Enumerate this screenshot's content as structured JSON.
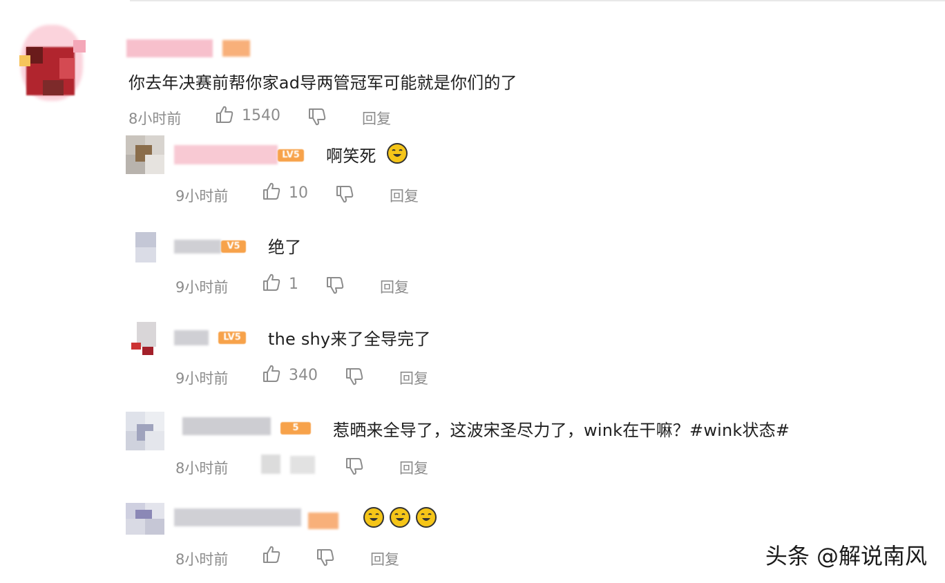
{
  "comments": [
    {
      "time": "8小时前",
      "likes": "1540",
      "reply_label": "回复",
      "text": "你去年决赛前帮你家ad导两管冠军可能就是你们的了"
    },
    {
      "time": "9小时前",
      "likes": "10",
      "reply_label": "回复",
      "text": "啊笑死",
      "badge": "LV5"
    },
    {
      "time": "9小时前",
      "likes": "1",
      "reply_label": "回复",
      "text": "绝了",
      "badge": "V5"
    },
    {
      "time": "9小时前",
      "likes": "340",
      "reply_label": "回复",
      "text": "the shy来了全导完了",
      "badge": "LV5"
    },
    {
      "time": "8小时前",
      "reply_label": "回复",
      "text": "惹晒来全导了，这波宋圣尽力了，wink在干嘛？#wink状态#",
      "badge": "5"
    },
    {
      "time": "8小时前",
      "reply_label": "回复"
    }
  ],
  "watermark": "头条 @解说南风",
  "icons": {
    "like": "thumbs-up-icon",
    "dislike": "thumbs-down-icon",
    "emoji": "laughing-emoji-icon"
  },
  "colors": {
    "meta_text": "#8c8c8c",
    "badge": "#f7a24a",
    "username_blur": "#f5b8c4"
  }
}
